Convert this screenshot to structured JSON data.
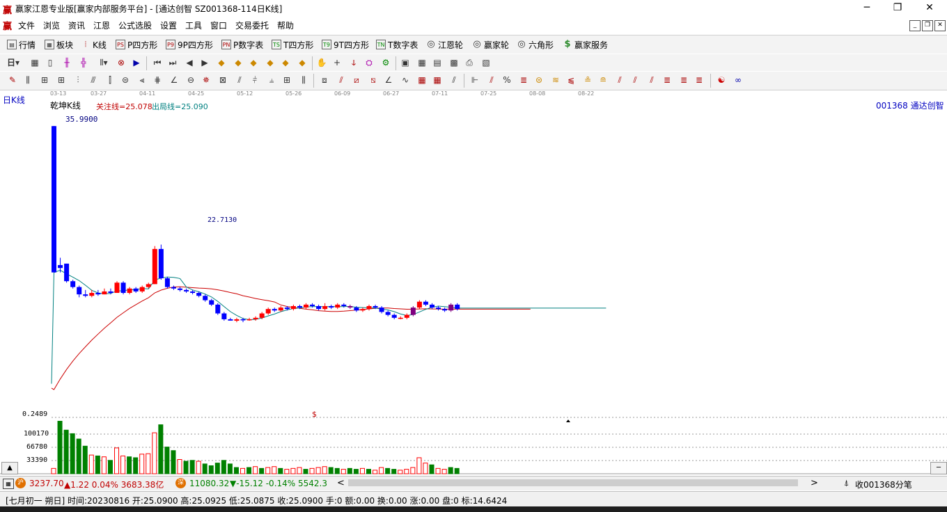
{
  "window": {
    "logo": "赢",
    "title": "赢家江恩专业版[赢家内部服务平台] - [通达创智   SZ001368-114日K线]",
    "min": "─",
    "restore": "❐",
    "close": "✕"
  },
  "menu": {
    "logo": "赢",
    "items": [
      "文件",
      "浏览",
      "资讯",
      "江恩",
      "公式选股",
      "设置",
      "工具",
      "窗口",
      "交易委托",
      "帮助"
    ],
    "mdi": [
      "_",
      "❐",
      "✕"
    ]
  },
  "toolbar1": [
    {
      "icon": "grid-icon",
      "glyph": "▤",
      "label": "行情"
    },
    {
      "icon": "blocks-icon",
      "glyph": "▦",
      "label": "板块"
    },
    {
      "icon": "kline-icon",
      "glyph": "┆",
      "label": "K线"
    },
    {
      "icon": "ps-icon",
      "glyph": "PS",
      "label": "P四方形"
    },
    {
      "icon": "p9-icon",
      "glyph": "P9",
      "label": "9P四方形"
    },
    {
      "icon": "pn-icon",
      "glyph": "PN",
      "label": "P数字表"
    },
    {
      "icon": "ts-icon",
      "glyph": "TS",
      "label": "T四方形"
    },
    {
      "icon": "t9-icon",
      "glyph": "T9",
      "label": "9T四方形"
    },
    {
      "icon": "tn-icon",
      "glyph": "TN",
      "label": "T数字表"
    },
    {
      "icon": "wheel-icon",
      "glyph": "◎",
      "label": "江恩轮"
    },
    {
      "icon": "winwheel-icon",
      "glyph": "◎",
      "label": "赢家轮"
    },
    {
      "icon": "hexagon-icon",
      "glyph": "◎",
      "label": "六角形"
    },
    {
      "icon": "dollar-icon",
      "glyph": "$",
      "label": "赢家服务"
    }
  ],
  "chart": {
    "period_label": "日K线",
    "indicator_name": "乾坤K线",
    "watch_line": "关注线=25.078",
    "exit_line": "出局线=25.090",
    "stock_label": "001368 通达创智",
    "high_label": "35.9900",
    "low_label": "22.7130",
    "dates": [
      "03-13",
      "03-27",
      "04-11",
      "04-25",
      "05-12",
      "05-26",
      "06-09",
      "06-27",
      "07-11",
      "07-25",
      "08-08",
      "08-22"
    ],
    "volume_axis": [
      "0.2489",
      "100170",
      "66780",
      "33390"
    ],
    "dollar_mark": "$",
    "colors": {
      "up": "#ff0000",
      "down": "#0000ff",
      "neutral": "#800080",
      "ma_fast": "#008080",
      "ma_slow": "#cc0000",
      "volume_up": "#ff0000",
      "volume_down": "#008000"
    },
    "price_range": [
      18,
      37
    ],
    "candles": [
      [
        35.99,
        26,
        36,
        26
      ],
      [
        26.5,
        26.3,
        27,
        26
      ],
      [
        26.6,
        25.4,
        26.6,
        25.3
      ],
      [
        25.4,
        25,
        25.5,
        24.9
      ],
      [
        25,
        24.5,
        25.1,
        24.3
      ],
      [
        24.5,
        24.4,
        24.8,
        24.3
      ],
      [
        24.4,
        24.6,
        24.8,
        24.3
      ],
      [
        24.6,
        24.5,
        24.8,
        24.4
      ],
      [
        24.5,
        24.7,
        24.9,
        24.5
      ],
      [
        24.7,
        24.6,
        24.9,
        24.5
      ],
      [
        24.6,
        25.3,
        25.4,
        24.6
      ],
      [
        25.3,
        24.6,
        25.4,
        24.5
      ],
      [
        24.6,
        24.9,
        25,
        24.5
      ],
      [
        24.9,
        24.7,
        25,
        24.6
      ],
      [
        24.7,
        25,
        25.1,
        24.6
      ],
      [
        25,
        25.2,
        25.3,
        24.9
      ],
      [
        25.2,
        27.6,
        27.8,
        25.2
      ],
      [
        27.6,
        25.6,
        27.9,
        25.5
      ],
      [
        25.6,
        25,
        25.7,
        24.9
      ],
      [
        25,
        24.9,
        25.1,
        24.8
      ],
      [
        24.9,
        24.8,
        25,
        24.7
      ],
      [
        24.8,
        24.7,
        24.9,
        24.6
      ],
      [
        24.7,
        24.6,
        24.8,
        24.5
      ],
      [
        24.6,
        24.4,
        24.7,
        24.3
      ],
      [
        24.4,
        24.1,
        24.5,
        24
      ],
      [
        24.1,
        23.8,
        24.2,
        23.7
      ],
      [
        23.8,
        23.2,
        23.9,
        23.1
      ],
      [
        23.2,
        22.8,
        23.3,
        22.7
      ],
      [
        22.8,
        22.71,
        22.9,
        22.71
      ],
      [
        22.7,
        22.8,
        22.9,
        22.6
      ],
      [
        22.8,
        22.75,
        22.9,
        22.6
      ],
      [
        22.75,
        22.8,
        22.9,
        22.7
      ],
      [
        22.8,
        22.9,
        23,
        22.7
      ],
      [
        22.9,
        23.2,
        23.3,
        22.8
      ],
      [
        23.2,
        23.5,
        23.6,
        23.1
      ],
      [
        23.5,
        23.4,
        23.6,
        23.3
      ],
      [
        23.4,
        23.6,
        23.7,
        23.3
      ],
      [
        23.6,
        23.5,
        23.7,
        23.4
      ],
      [
        23.5,
        23.7,
        23.8,
        23.4
      ],
      [
        23.7,
        23.6,
        23.8,
        23.5
      ],
      [
        23.6,
        23.8,
        23.9,
        23.5
      ],
      [
        23.8,
        23.7,
        23.9,
        23.6
      ],
      [
        23.7,
        23.5,
        23.8,
        23.4
      ],
      [
        23.5,
        23.7,
        23.9,
        23.4
      ],
      [
        23.7,
        23.6,
        23.8,
        23.5
      ],
      [
        23.6,
        23.8,
        23.9,
        23.5
      ],
      [
        23.8,
        23.7,
        23.9,
        23.6
      ],
      [
        23.7,
        23.6,
        23.8,
        23.5
      ],
      [
        23.6,
        23.4,
        23.7,
        23.3
      ],
      [
        23.4,
        23.5,
        23.6,
        23.3
      ],
      [
        23.5,
        23.7,
        23.8,
        23.4
      ],
      [
        23.7,
        23.6,
        23.8,
        23.5
      ],
      [
        23.6,
        23.3,
        23.7,
        23.2
      ],
      [
        23.3,
        23.1,
        23.4,
        23
      ],
      [
        23.1,
        22.9,
        23.2,
        22.8
      ],
      [
        22.9,
        22.9,
        23,
        22.8
      ],
      [
        22.9,
        23.1,
        23.2,
        22.8
      ],
      [
        23.1,
        23.6,
        23.7,
        23
      ],
      [
        23.6,
        24,
        24.1,
        23.5
      ],
      [
        24,
        23.8,
        24.1,
        23.7
      ],
      [
        23.8,
        23.6,
        23.9,
        23.5
      ],
      [
        23.6,
        23.5,
        23.7,
        23.4
      ],
      [
        23.5,
        23.4,
        23.6,
        23.3
      ],
      [
        23.4,
        23.8,
        23.9,
        23.3
      ],
      [
        23.8,
        23.5,
        23.9,
        23.4
      ]
    ],
    "volume_bars": [
      [
        12000,
        "up"
      ],
      [
        118000,
        "down"
      ],
      [
        98000,
        "down"
      ],
      [
        90000,
        "down"
      ],
      [
        78000,
        "down"
      ],
      [
        62000,
        "down"
      ],
      [
        42000,
        "up"
      ],
      [
        40000,
        "down"
      ],
      [
        38000,
        "up"
      ],
      [
        30000,
        "down"
      ],
      [
        58000,
        "up"
      ],
      [
        40000,
        "up"
      ],
      [
        38000,
        "down"
      ],
      [
        36000,
        "down"
      ],
      [
        44000,
        "up"
      ],
      [
        45000,
        "up"
      ],
      [
        92000,
        "up"
      ],
      [
        110000,
        "down"
      ],
      [
        60000,
        "down"
      ],
      [
        52000,
        "down"
      ],
      [
        32000,
        "up"
      ],
      [
        28000,
        "down"
      ],
      [
        30000,
        "down"
      ],
      [
        28000,
        "up"
      ],
      [
        22000,
        "down"
      ],
      [
        18000,
        "down"
      ],
      [
        24000,
        "down"
      ],
      [
        30000,
        "down"
      ],
      [
        22000,
        "down"
      ],
      [
        14000,
        "down"
      ],
      [
        12000,
        "up"
      ],
      [
        14000,
        "down"
      ],
      [
        16000,
        "up"
      ],
      [
        12000,
        "down"
      ],
      [
        14000,
        "up"
      ],
      [
        16000,
        "up"
      ],
      [
        12000,
        "down"
      ],
      [
        10000,
        "up"
      ],
      [
        12000,
        "up"
      ],
      [
        14000,
        "up"
      ],
      [
        10000,
        "down"
      ],
      [
        12000,
        "up"
      ],
      [
        14000,
        "up"
      ],
      [
        16000,
        "up"
      ],
      [
        14000,
        "down"
      ],
      [
        12000,
        "down"
      ],
      [
        10000,
        "up"
      ],
      [
        12000,
        "down"
      ],
      [
        10000,
        "down"
      ],
      [
        12000,
        "up"
      ],
      [
        10000,
        "down"
      ],
      [
        8000,
        "up"
      ],
      [
        14000,
        "up"
      ],
      [
        12000,
        "down"
      ],
      [
        10000,
        "down"
      ],
      [
        8000,
        "up"
      ],
      [
        10000,
        "up"
      ],
      [
        14000,
        "up"
      ],
      [
        36000,
        "up"
      ],
      [
        24000,
        "up"
      ],
      [
        20000,
        "down"
      ],
      [
        12000,
        "up"
      ],
      [
        10000,
        "up"
      ],
      [
        14000,
        "down"
      ],
      [
        12000,
        "down"
      ]
    ]
  },
  "scrollbar": {
    "left_arrow": "<",
    "right_arrow": ">",
    "sh_logo": "沪",
    "sh_index": "3237.70",
    "sh_change": "▲1.22 0.04% 3683.38亿",
    "sz_logo": "深",
    "sz_index": "11080.32",
    "sz_change": "▼-15.12 -0.14% 5542.38",
    "receive": "收001368分笔",
    "up_triangle": "▲",
    "minus": "─"
  },
  "infobar": {
    "text": "[七月初一  朔日] 时间:20230816 开:25.0900 高:25.0925 低:25.0875 收:25.0900 手:0 额:0.00 换:0.00 涨:0.00 盘:0 标:14.6424"
  }
}
